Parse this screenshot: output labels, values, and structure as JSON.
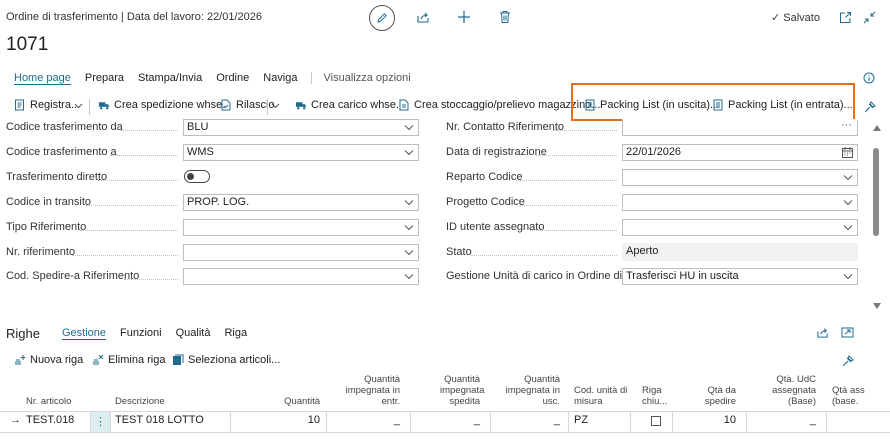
{
  "header": {
    "breadcrumb": "Ordine di trasferimento | Data del lavoro: 22/01/2026",
    "title": "1071",
    "saved_label": "Salvato"
  },
  "tabs": [
    "Home page",
    "Prepara",
    "Stampa/Invia",
    "Ordine",
    "Naviga"
  ],
  "show_options": "Visualizza opzioni",
  "commands": {
    "register": "Registra...",
    "create_shipment": "Crea spedizione whse.",
    "release": "Rilascio",
    "create_receipt": "Crea carico whse.",
    "create_putaway": "Crea stoccaggio/prelievo magazzino...",
    "packing_out": "Packing List (in uscita)...",
    "packing_in": "Packing List (in entrata)..."
  },
  "form": {
    "left": [
      {
        "label": "Codice trasferimento da",
        "value": "BLU",
        "type": "select"
      },
      {
        "label": "Codice trasferimento a",
        "value": "WMS",
        "type": "select"
      },
      {
        "label": "Trasferimento diretto",
        "value": "",
        "type": "toggle"
      },
      {
        "label": "Codice in transito",
        "value": "PROP. LOG.",
        "type": "select"
      },
      {
        "label": "Tipo Riferimento",
        "value": "",
        "type": "select"
      },
      {
        "label": "Nr. riferimento",
        "value": "",
        "type": "select"
      },
      {
        "label": "Cod. Spedire-a Riferimento",
        "value": "",
        "type": "select"
      }
    ],
    "right": [
      {
        "label": "Nr. Contatto Riferimento",
        "value": "",
        "type": "lookup"
      },
      {
        "label": "Data di registrazione",
        "value": "22/01/2026",
        "type": "date"
      },
      {
        "label": "Reparto Codice",
        "value": "",
        "type": "select"
      },
      {
        "label": "Progetto Codice",
        "value": "",
        "type": "select"
      },
      {
        "label": "ID utente assegnato",
        "value": "",
        "type": "select"
      },
      {
        "label": "Stato",
        "value": "Aperto",
        "type": "readonly"
      },
      {
        "label": "Gestione Unità di carico in Ordine di T...",
        "value": "Trasferisci HU in uscita",
        "type": "select"
      }
    ]
  },
  "lines": {
    "title": "Righe",
    "tabs": [
      "Gestione",
      "Funzioni",
      "Qualità",
      "Riga"
    ],
    "actions": [
      "Nuova riga",
      "Elimina riga",
      "Seleziona articoli..."
    ],
    "columns": [
      "Nr. articolo",
      "Descrizione",
      "Quantità",
      "Quantità impegnata in entr.",
      "Quantità impegnata spedita",
      "Quantità impegnata in usc.",
      "Cod. unità di misura",
      "Riga chiu...",
      "Qtà da spedire",
      "Qtà. UdC assegnata (Base)",
      "Qtà ass (base."
    ],
    "row": {
      "item_no": "TEST.018",
      "more": "⋮",
      "description": "TEST 018 LOTTO",
      "quantity": "10",
      "res_in": "_",
      "res_shipped": "_",
      "res_out": "_",
      "uom": "PZ",
      "closed": false,
      "qty_to_ship": "10",
      "hu_assigned": "_"
    }
  },
  "colors": {
    "accent": "#1f6b8e",
    "highlight": "#e36f1e"
  }
}
